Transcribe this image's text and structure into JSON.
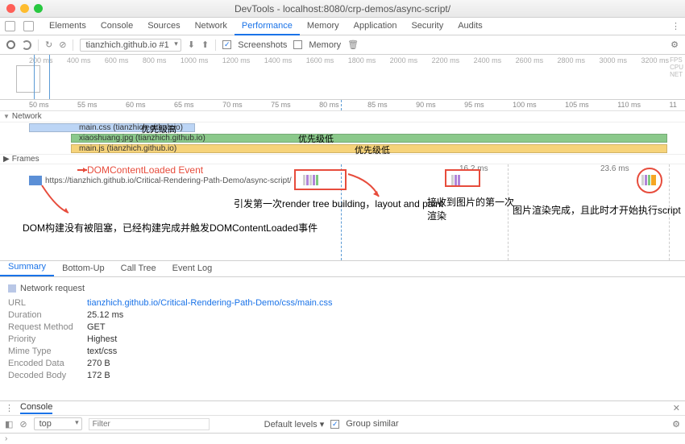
{
  "window": {
    "title": "DevTools - localhost:8080/crp-demos/async-script/"
  },
  "tabs": [
    "Elements",
    "Console",
    "Sources",
    "Network",
    "Performance",
    "Memory",
    "Application",
    "Security",
    "Audits"
  ],
  "active_tab": "Performance",
  "toolbar2": {
    "profile_dropdown": "tianzhich.github.io #1",
    "screenshots_label": "Screenshots",
    "memory_label": "Memory"
  },
  "overview": {
    "ticks": [
      "200 ms",
      "400 ms",
      "600 ms",
      "800 ms",
      "1000 ms",
      "1200 ms",
      "1400 ms",
      "1600 ms",
      "1800 ms",
      "2000 ms",
      "2200 ms",
      "2400 ms",
      "2600 ms",
      "2800 ms",
      "3000 ms",
      "3200 ms"
    ],
    "rightlabels": [
      "FPS",
      "CPU",
      "NET"
    ]
  },
  "ruler2": {
    "ticks": [
      "50 ms",
      "55 ms",
      "60 ms",
      "65 ms",
      "70 ms",
      "75 ms",
      "80 ms",
      "85 ms",
      "90 ms",
      "95 ms",
      "100 ms",
      "105 ms",
      "110 ms",
      "11"
    ]
  },
  "sections": {
    "network": "Network",
    "frames": "Frames"
  },
  "network_rows": [
    {
      "file": "main.css (tianzhich.github.io)",
      "priority": "优先级高"
    },
    {
      "file": "xiaoshuang.jpg (tianzhich.github.io)",
      "priority": "优先级低"
    },
    {
      "file": "main.js (tianzhich.github.io)",
      "priority": "优先级低"
    }
  ],
  "main": {
    "dcl_label": "DOMContentLoaded Event",
    "url": "https://tianzhich.github.io/Critical-Rendering-Path-Demo/async-script/",
    "dur1": "16.2 ms",
    "dur2": "23.6 ms"
  },
  "annotations": {
    "a1": "DOM构建没有被阻塞，已经构建完成并触发DOMContentLoaded事件",
    "a2": "引发第一次render tree building，layout and paint",
    "a3": "接收到图片的第一次渲染",
    "a4": "图片渲染完成，且此时才开始执行script"
  },
  "summary": {
    "tabs": [
      "Summary",
      "Bottom-Up",
      "Call Tree",
      "Event Log"
    ],
    "title": "Network request",
    "url_label": "URL",
    "url": "tianzhich.github.io/Critical-Rendering-Path-Demo/css/main.css",
    "duration_label": "Duration",
    "duration": "25.12 ms",
    "method_label": "Request Method",
    "method": "GET",
    "priority_label": "Priority",
    "priority": "Highest",
    "mime_label": "Mime Type",
    "mime": "text/css",
    "enc_label": "Encoded Data",
    "enc": "270 B",
    "dec_label": "Decoded Body",
    "dec": "172 B"
  },
  "console": {
    "tab": "Console",
    "scope": "top",
    "filter_ph": "Filter",
    "levels": "Default levels ▾",
    "group": "Group similar"
  },
  "prompt": "›"
}
